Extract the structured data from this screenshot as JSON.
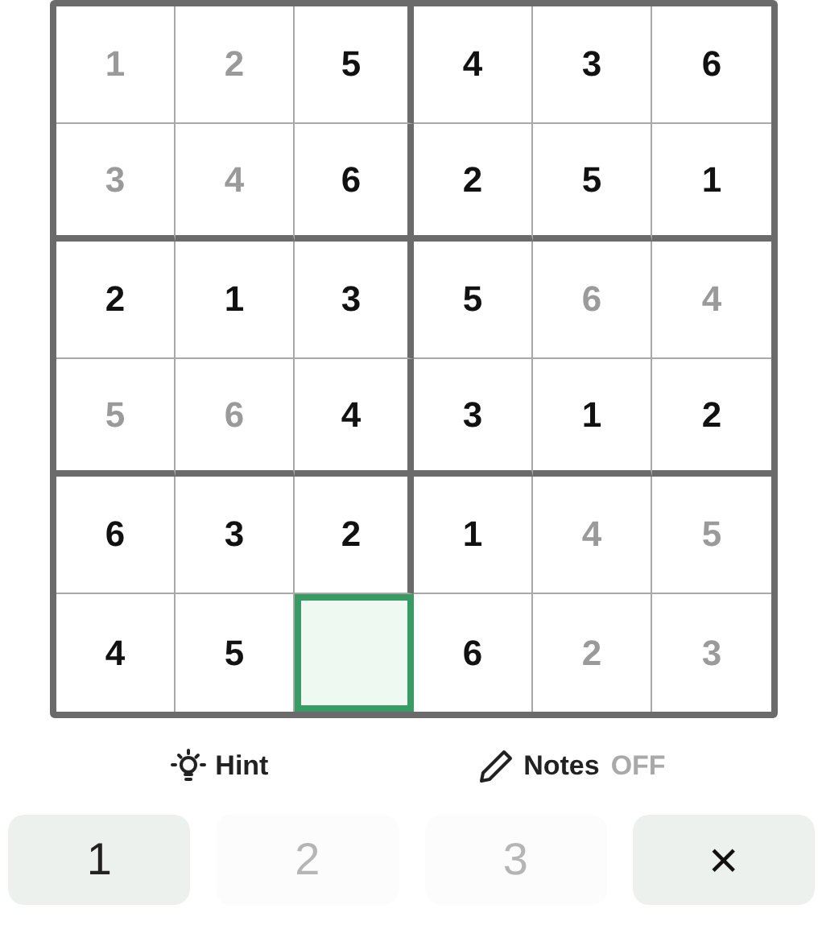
{
  "grid": {
    "rows": [
      {
        "cells": [
          {
            "value": "1",
            "faded": true,
            "selected": false
          },
          {
            "value": "2",
            "faded": true,
            "selected": false
          },
          {
            "value": "5",
            "faded": false,
            "selected": false
          },
          {
            "value": "4",
            "faded": false,
            "selected": false
          },
          {
            "value": "3",
            "faded": false,
            "selected": false
          },
          {
            "value": "6",
            "faded": false,
            "selected": false
          }
        ]
      },
      {
        "cells": [
          {
            "value": "3",
            "faded": true,
            "selected": false
          },
          {
            "value": "4",
            "faded": true,
            "selected": false
          },
          {
            "value": "6",
            "faded": false,
            "selected": false
          },
          {
            "value": "2",
            "faded": false,
            "selected": false
          },
          {
            "value": "5",
            "faded": false,
            "selected": false
          },
          {
            "value": "1",
            "faded": false,
            "selected": false
          }
        ]
      },
      {
        "cells": [
          {
            "value": "2",
            "faded": false,
            "selected": false
          },
          {
            "value": "1",
            "faded": false,
            "selected": false
          },
          {
            "value": "3",
            "faded": false,
            "selected": false
          },
          {
            "value": "5",
            "faded": false,
            "selected": false
          },
          {
            "value": "6",
            "faded": true,
            "selected": false
          },
          {
            "value": "4",
            "faded": true,
            "selected": false
          }
        ]
      },
      {
        "cells": [
          {
            "value": "5",
            "faded": true,
            "selected": false
          },
          {
            "value": "6",
            "faded": true,
            "selected": false
          },
          {
            "value": "4",
            "faded": false,
            "selected": false
          },
          {
            "value": "3",
            "faded": false,
            "selected": false
          },
          {
            "value": "1",
            "faded": false,
            "selected": false
          },
          {
            "value": "2",
            "faded": false,
            "selected": false
          }
        ]
      },
      {
        "cells": [
          {
            "value": "6",
            "faded": false,
            "selected": false
          },
          {
            "value": "3",
            "faded": false,
            "selected": false
          },
          {
            "value": "2",
            "faded": false,
            "selected": false
          },
          {
            "value": "1",
            "faded": false,
            "selected": false
          },
          {
            "value": "4",
            "faded": true,
            "selected": false
          },
          {
            "value": "5",
            "faded": true,
            "selected": false
          }
        ]
      },
      {
        "cells": [
          {
            "value": "4",
            "faded": false,
            "selected": false
          },
          {
            "value": "5",
            "faded": false,
            "selected": false
          },
          {
            "selected": true
          },
          {
            "value": "6",
            "faded": false,
            "selected": false
          },
          {
            "value": "2",
            "faded": true,
            "selected": false
          },
          {
            "value": "3",
            "faded": true,
            "selected": false
          }
        ]
      }
    ]
  },
  "hint": {
    "label": "Hint"
  },
  "notes": {
    "label": "Notes",
    "status": "OFF",
    "on": false
  },
  "keypad": [
    {
      "kind": "number",
      "label": "1",
      "disabled": false
    },
    {
      "kind": "number",
      "label": "2",
      "disabled": true
    },
    {
      "kind": "number",
      "label": "3",
      "disabled": true
    },
    {
      "kind": "erase",
      "label": "×",
      "disabled": false
    }
  ]
}
